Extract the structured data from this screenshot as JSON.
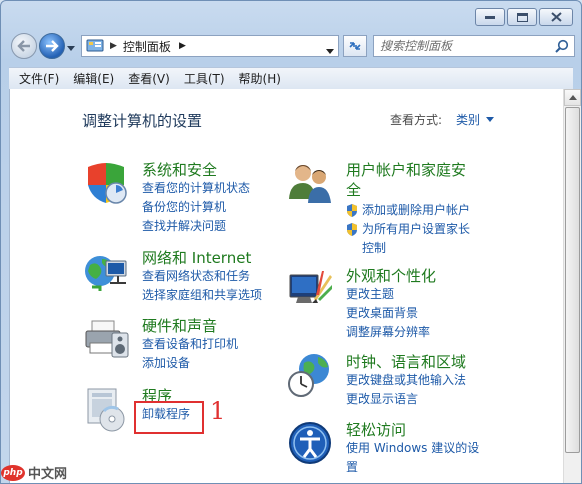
{
  "window": {
    "caption_buttons": [
      "minimize",
      "maximize",
      "close"
    ]
  },
  "nav": {
    "address_segments": [
      "控制面板"
    ],
    "search_placeholder": "搜索控制面板"
  },
  "menu": [
    "文件(F)",
    "编辑(E)",
    "查看(V)",
    "工具(T)",
    "帮助(H)"
  ],
  "content": {
    "page_title": "调整计算机的设置",
    "view_by_label": "查看方式:",
    "view_by_value": "类别",
    "left_categories": [
      {
        "title": "系统和安全",
        "icon": "shield-icon",
        "links": [
          "查看您的计算机状态",
          "备份您的计算机",
          "查找并解决问题"
        ]
      },
      {
        "title": "网络和 Internet",
        "icon": "network-icon",
        "links": [
          "查看网络状态和任务",
          "选择家庭组和共享选项"
        ]
      },
      {
        "title": "硬件和声音",
        "icon": "printer-icon",
        "links": [
          "查看设备和打印机",
          "添加设备"
        ]
      },
      {
        "title": "程序",
        "icon": "programs-icon",
        "links": [
          "卸载程序"
        ]
      }
    ],
    "right_categories": [
      {
        "title_line1": "用户帐户和家庭安",
        "title_line2": "全",
        "icon": "users-icon",
        "links": [
          "添加或删除用户帐户",
          "为所有用户设置家长",
          "控制"
        ]
      },
      {
        "title": "外观和个性化",
        "icon": "appearance-icon",
        "links": [
          "更改主题",
          "更改桌面背景",
          "调整屏幕分辨率"
        ]
      },
      {
        "title": "时钟、语言和区域",
        "icon": "clock-globe-icon",
        "links": [
          "更改键盘或其他输入法",
          "更改显示语言"
        ]
      },
      {
        "title": "轻松访问",
        "icon": "ease-of-access-icon",
        "links": [
          "使用 Windows 建议的设",
          "置"
        ]
      }
    ]
  },
  "annotation": {
    "number": "1",
    "color": "#e03030"
  },
  "watermark": {
    "logo_text": "php",
    "text": "中文网"
  },
  "colors": {
    "category_title": "#1f7a1f",
    "link": "#1e5aa8",
    "page_title": "#1e395b"
  }
}
